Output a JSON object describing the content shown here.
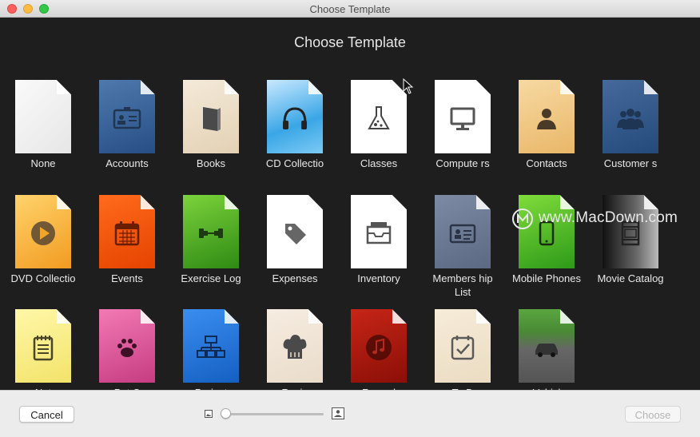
{
  "window": {
    "title": "Choose Template"
  },
  "dialog": {
    "heading": "Choose Template"
  },
  "templates": [
    {
      "label": "None",
      "icon": "blank-document-icon"
    },
    {
      "label": "Accounts",
      "icon": "id-card-icon"
    },
    {
      "label": "Books",
      "icon": "book-icon"
    },
    {
      "label": "CD Collectio",
      "icon": "headphones-icon"
    },
    {
      "label": "Classes",
      "icon": "flask-icon"
    },
    {
      "label": "Compute rs",
      "icon": "monitor-icon"
    },
    {
      "label": "Contacts",
      "icon": "person-icon"
    },
    {
      "label": "Customer s",
      "icon": "people-group-icon"
    },
    {
      "label": "DVD Collectio",
      "icon": "play-icon"
    },
    {
      "label": "Events",
      "icon": "calendar-icon"
    },
    {
      "label": "Exercise Log",
      "icon": "dumbbell-icon"
    },
    {
      "label": "Expenses",
      "icon": "price-tag-icon"
    },
    {
      "label": "Inventory",
      "icon": "inbox-tray-icon"
    },
    {
      "label": "Members hip List",
      "icon": "membership-card-icon"
    },
    {
      "label": "Mobile Phones",
      "icon": "smartphone-icon"
    },
    {
      "label": "Movie Catalog",
      "icon": "film-strip-icon"
    },
    {
      "label": "Not",
      "icon": "notepad-icon"
    },
    {
      "label": "Pet C",
      "icon": "paw-icon"
    },
    {
      "label": "Project",
      "icon": "org-chart-icon"
    },
    {
      "label": "Recip",
      "icon": "chef-hat-icon"
    },
    {
      "label": "Record",
      "icon": "music-note-icon"
    },
    {
      "label": "To D",
      "icon": "checklist-icon"
    },
    {
      "label": "Vehicl",
      "icon": "car-icon"
    }
  ],
  "footer": {
    "cancel_label": "Cancel",
    "choose_label": "Choose",
    "zoom_slider_value": 0
  },
  "watermark": {
    "text": "www.MacDown.com"
  }
}
